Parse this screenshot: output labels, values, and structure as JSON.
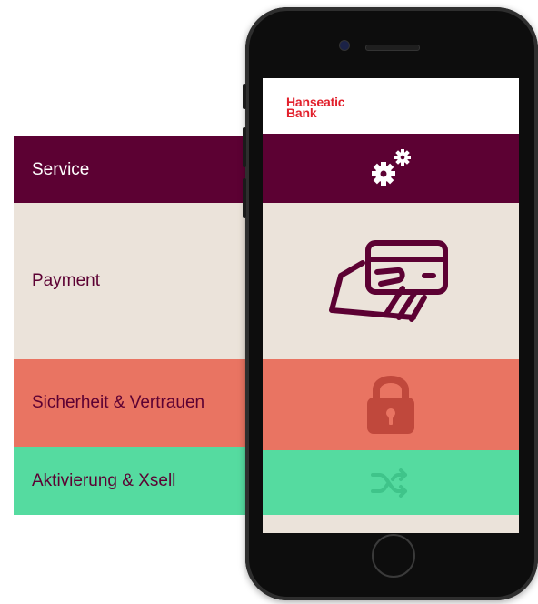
{
  "categories": {
    "service": "Service",
    "payment": "Payment",
    "security": "Sicherheit & Vertrauen",
    "activation": "Aktivierung & Xsell"
  },
  "brand": {
    "line1": "Hanseatic",
    "line2": "Bank"
  },
  "colors": {
    "service": "#5c0133",
    "payment": "#ebe3da",
    "security": "#e97462",
    "activation": "#55dba0",
    "brand_red": "#e2202c"
  },
  "icons": {
    "service": "gears-icon",
    "payment": "card-in-hand-icon",
    "security": "padlock-icon",
    "activation": "shuffle-icon"
  }
}
